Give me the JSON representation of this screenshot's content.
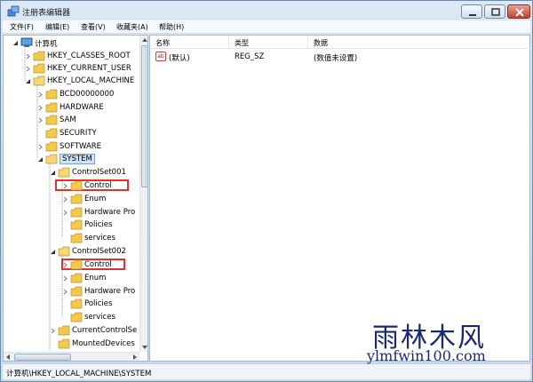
{
  "window": {
    "title": "注册表编辑器",
    "controls": {
      "minimize": "minimize-icon",
      "maximize": "maximize-icon",
      "close": "close-icon"
    }
  },
  "menu": [
    "文件(F)",
    "编辑(E)",
    "查看(V)",
    "收藏夹(A)",
    "帮助(H)"
  ],
  "tree": {
    "root": "计算机",
    "hkcr": "HKEY_CLASSES_ROOT",
    "hkcu": "HKEY_CURRENT_USER",
    "hklm": "HKEY_LOCAL_MACHINE",
    "bcd": "BCD00000000",
    "hardware": "HARDWARE",
    "sam": "SAM",
    "security": "SECURITY",
    "software": "SOFTWARE",
    "system": "SYSTEM",
    "cs001": "ControlSet001",
    "cs001_control": "Control",
    "cs001_enum": "Enum",
    "cs001_hwprofiles": "Hardware Pro",
    "cs001_policies": "Policies",
    "cs001_services": "services",
    "cs002": "ControlSet002",
    "cs002_control": "Control",
    "cs002_enum": "Enum",
    "cs002_hwprofiles": "Hardware Pro",
    "cs002_policies": "Policies",
    "cs002_services": "services",
    "ccs": "CurrentControlSe",
    "mounted": "MountedDevices"
  },
  "list": {
    "columns": [
      "名称",
      "类型",
      "数据"
    ],
    "rows": [
      {
        "name": "(默认)",
        "type": "REG_SZ",
        "data": "(数值未设置)",
        "icon_text": "ab"
      }
    ]
  },
  "status": "计算机\\HKEY_LOCAL_MACHINE\\SYSTEM",
  "watermark": {
    "cn": "雨林木风",
    "en": "ylmfwin100.com"
  },
  "colors": {
    "highlight_box": "#e03030",
    "selected_bg": "#cce3f8",
    "folder": "#f2c94c",
    "watermark": "#1a2a6e"
  }
}
